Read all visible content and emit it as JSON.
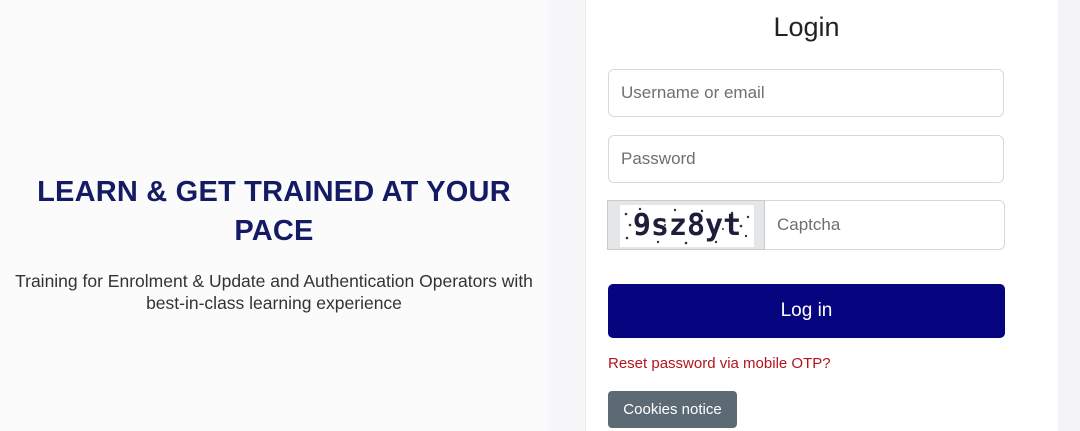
{
  "hero": {
    "title_line1": "LEARN & GET TRAINED AT YOUR",
    "title_line2": "PACE",
    "subtitle_line1": "Training for Enrolment & Update and Authentication Operators with",
    "subtitle_line2": "best-in-class learning experience"
  },
  "login": {
    "title": "Login",
    "username_placeholder": "Username or email",
    "password_placeholder": "Password",
    "captcha_image_text": "9sz8yt",
    "captcha_placeholder": "Captcha",
    "submit_label": "Log in",
    "reset_link": "Reset password via mobile OTP?",
    "cookies_label": "Cookies notice"
  },
  "colors": {
    "hero_title": "#141a63",
    "primary_button": "#06047f",
    "reset_link": "#b2141b",
    "cookies_button": "#5c6b73"
  }
}
